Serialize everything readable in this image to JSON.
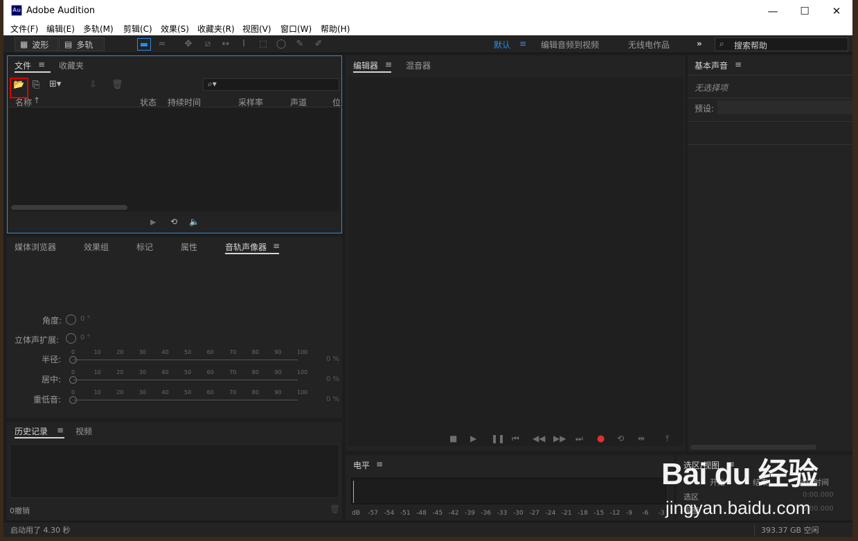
{
  "window": {
    "title": "Adobe Audition",
    "logo": "Au",
    "minimize": "—",
    "maximize": "☐",
    "close": "✕"
  },
  "menu": [
    "文件(F)",
    "编辑(E)",
    "多轨(M)",
    "剪辑(C)",
    "效果(S)",
    "收藏夹(R)",
    "视图(V)",
    "窗口(W)",
    "帮助(H)"
  ],
  "toolbar": {
    "waveform_label": "波形",
    "multitrack_label": "多轨",
    "workspaces": [
      "默认",
      "编辑音频到视频",
      "无线电作品"
    ],
    "more": "»",
    "search_placeholder": "搜索帮助"
  },
  "files_panel": {
    "tabs": [
      "文件",
      "收藏夹"
    ],
    "columns": [
      "名称",
      "状态",
      "持续时间",
      "采样率",
      "声道",
      "位"
    ]
  },
  "editor": {
    "tabs": [
      "编辑器",
      "混音器"
    ]
  },
  "essential_sound": {
    "title": "基本声音",
    "no_selection": "无选择项",
    "preset_label": "预设:"
  },
  "lower_panel": {
    "tabs": [
      "媒体浏览器",
      "效果组",
      "标记",
      "属性",
      "音轨声像器"
    ],
    "angle_label": "角度:",
    "angle_value": "0 °",
    "stereo_label": "立体声扩展:",
    "stereo_value": "0 °",
    "sliders": [
      {
        "label": "半径:",
        "value": "0 %"
      },
      {
        "label": "居中:",
        "value": "0 %"
      },
      {
        "label": "重低音:",
        "value": "0 %"
      }
    ],
    "ticks": [
      "0",
      "10",
      "20",
      "30",
      "40",
      "50",
      "60",
      "70",
      "80",
      "90",
      "100"
    ]
  },
  "history": {
    "tabs": [
      "历史记录",
      "视频"
    ],
    "undo_count": "0撤销"
  },
  "level_meter": {
    "title": "电平",
    "scale": [
      "dB",
      "-57",
      "-54",
      "-51",
      "-48",
      "-45",
      "-42",
      "-39",
      "-36",
      "-33",
      "-30",
      "-27",
      "-24",
      "-21",
      "-18",
      "-15",
      "-12",
      "-9",
      "-6",
      "-3"
    ]
  },
  "selection_view": {
    "title": "选区/视图",
    "columns": [
      "开始",
      "结束",
      "持续时间"
    ],
    "rows": [
      "选区",
      "视图"
    ],
    "values": [
      "0:00.000",
      "0:00.000"
    ]
  },
  "status": {
    "startup": "启动用了 4.30 秒",
    "disk_free": "393.37 GB 空闲"
  },
  "accent_color": "#2d8ceb",
  "watermark": {
    "logo": "Bai du 经验",
    "url": "jingyan.baidu.com"
  }
}
